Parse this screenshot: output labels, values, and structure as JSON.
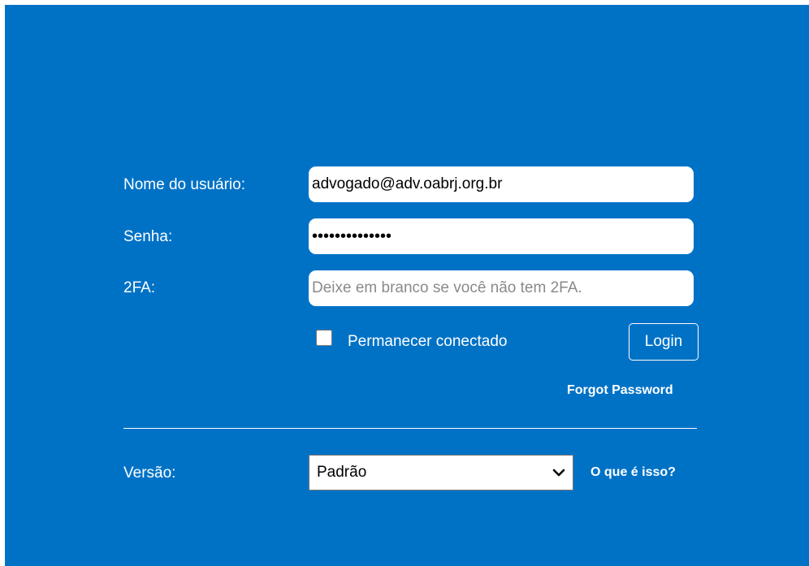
{
  "form": {
    "username_label": "Nome do usuário:",
    "username_value": "advogado@adv.oabrj.org.br",
    "password_label": "Senha:",
    "password_value": "**************",
    "twofa_label": "2FA:",
    "twofa_placeholder": "Deixe em branco se você não tem 2FA.",
    "remember_label": "Permanecer conectado",
    "remember_checked": false,
    "login_label": "Login",
    "forgot_password_label": "Forgot Password"
  },
  "version": {
    "label": "Versão:",
    "selected": "Padrão",
    "help_link": "O que é isso?",
    "dropdown_icon": "chevron-down-icon"
  },
  "colors": {
    "panel_background": "#0072c6",
    "text": "#ffffff",
    "field_background": "#ffffff"
  }
}
